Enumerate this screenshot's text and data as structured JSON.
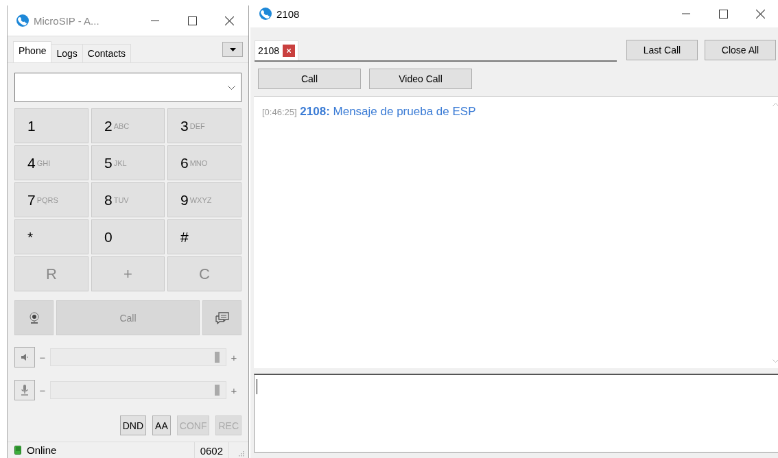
{
  "dialer_window": {
    "title": "MicroSIP - A...",
    "tabs": [
      {
        "label": "Phone",
        "selected": true
      },
      {
        "label": "Logs",
        "selected": false
      },
      {
        "label": "Contacts",
        "selected": false
      }
    ],
    "keypad": [
      {
        "kind": "digit",
        "digit": "1"
      },
      {
        "kind": "digit",
        "digit": "2",
        "letters": "ABC"
      },
      {
        "kind": "digit",
        "digit": "3",
        "letters": "DEF"
      },
      {
        "kind": "digit",
        "digit": "4",
        "letters": "GHI"
      },
      {
        "kind": "digit",
        "digit": "5",
        "letters": "JKL"
      },
      {
        "kind": "digit",
        "digit": "6",
        "letters": "MNO"
      },
      {
        "kind": "digit",
        "digit": "7",
        "letters": "PQRS"
      },
      {
        "kind": "digit",
        "digit": "8",
        "letters": "TUV"
      },
      {
        "kind": "digit",
        "digit": "9",
        "letters": "WXYZ"
      },
      {
        "kind": "digit",
        "digit": "*"
      },
      {
        "kind": "digit",
        "digit": "0"
      },
      {
        "kind": "digit",
        "digit": "#"
      },
      {
        "kind": "function",
        "digit": "R"
      },
      {
        "kind": "function",
        "digit": "+"
      },
      {
        "kind": "function",
        "digit": "C"
      }
    ],
    "call_button": {
      "label": "Call",
      "disabled": true
    },
    "volume_controls": [
      {
        "kind": "speaker",
        "minus": "−",
        "plus": "+",
        "level": 0.97
      },
      {
        "kind": "microphone",
        "minus": "−",
        "plus": "+",
        "level": 0.97
      }
    ],
    "toggles": [
      {
        "label": "DND",
        "disabled": false
      },
      {
        "label": "AA",
        "disabled": false
      },
      {
        "label": "CONF",
        "disabled": true
      },
      {
        "label": "REC",
        "disabled": true
      }
    ],
    "status_bar": {
      "status": "Online",
      "extension": "0602"
    }
  },
  "chat_window": {
    "title": "2108",
    "tabs": [
      {
        "label": "2108",
        "selected": true
      }
    ],
    "top_buttons": [
      "Last Call",
      "Close All"
    ],
    "action_buttons": [
      "Call",
      "Video Call"
    ],
    "messages": [
      {
        "time": "[0:46:25]",
        "sender": "2108:",
        "text": "Mensaje de prueba de ESP"
      }
    ]
  }
}
